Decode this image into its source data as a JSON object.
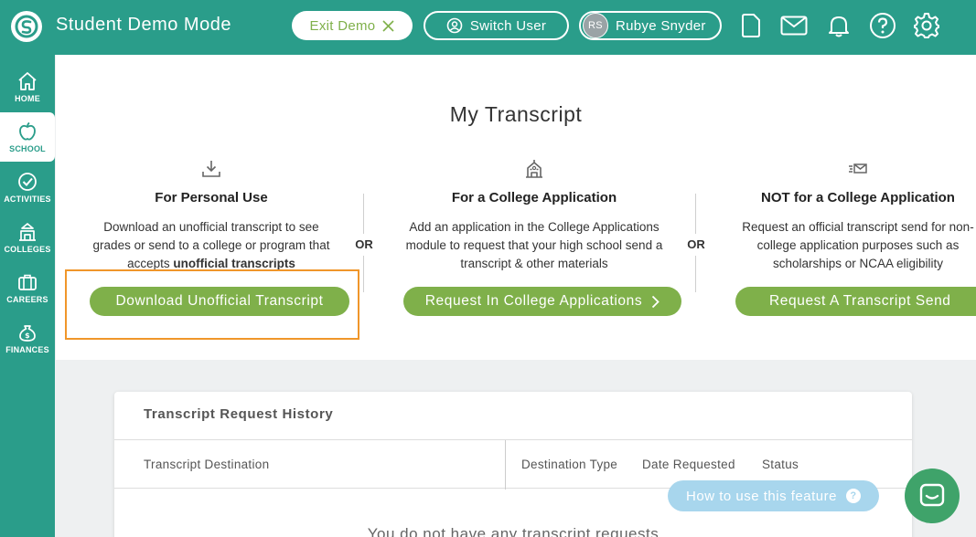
{
  "header": {
    "app_title": "Student Demo Mode",
    "exit_label": "Exit Demo",
    "switch_label": "Switch User",
    "user_initials": "RS",
    "user_name": "Rubye Snyder"
  },
  "sidebar": {
    "items": [
      {
        "label": "HOME",
        "icon": "home-icon"
      },
      {
        "label": "SCHOOL",
        "icon": "apple-icon"
      },
      {
        "label": "ACTIVITIES",
        "icon": "check-circle-icon"
      },
      {
        "label": "COLLEGES",
        "icon": "building-icon"
      },
      {
        "label": "CAREERS",
        "icon": "briefcase-icon"
      },
      {
        "label": "FINANCES",
        "icon": "money-bag-icon"
      }
    ]
  },
  "main": {
    "title": "My Transcript",
    "or_label": "OR",
    "options": [
      {
        "heading": "For Personal Use",
        "desc_lines": [
          "Download an unofficial transcript to see",
          "grades or send to a college or program that"
        ],
        "desc_last_prefix": "accepts ",
        "desc_last_bold": "unofficial transcripts",
        "button": "Download Unofficial Transcript",
        "icon": "download-icon"
      },
      {
        "heading": "For a College Application",
        "desc_lines": [
          "Add an application in the College Applications",
          "module to request that your high school send a",
          "transcript & other materials"
        ],
        "button": "Request In College Applications",
        "icon": "school-building-icon"
      },
      {
        "heading": "NOT for a College Application",
        "desc_lines": [
          "Request an official transcript send for non-",
          "college application purposes such as",
          "scholarships or NCAA eligibility"
        ],
        "button": "Request A Transcript Send",
        "icon": "send-mail-icon"
      }
    ]
  },
  "history": {
    "title": "Transcript Request History",
    "columns": [
      "Transcript Destination",
      "Destination Type",
      "Date Requested",
      "Status"
    ],
    "empty_message": "You do not have any transcript requests"
  },
  "help": {
    "label": "How to use this feature",
    "q": "?"
  },
  "colors": {
    "brand_teal": "#2a9d8a",
    "button_green": "#7fb04a",
    "highlight_orange": "#f0962a",
    "help_blue": "#a8d6ed",
    "chat_green": "#3fa36a"
  }
}
